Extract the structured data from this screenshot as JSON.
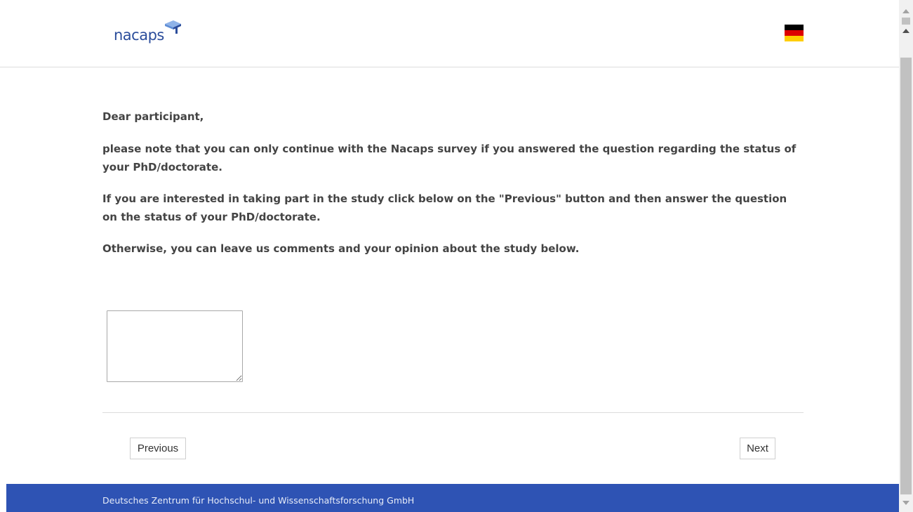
{
  "header": {
    "logo_text": "nacaps",
    "language_flag": "german-flag-icon"
  },
  "content": {
    "greeting": "Dear participant,",
    "paragraph1": "please note that you can only continue with the Nacaps survey if you answered the question regarding the status of your PhD/doctorate.",
    "paragraph2": "If you are interested in taking part in the study click below on the \"Previous\" button and then answer the question on the status of your PhD/doctorate.",
    "paragraph3": "Otherwise, you can leave us comments and your opinion about the study below.",
    "comment_value": ""
  },
  "navigation": {
    "previous_label": "Previous",
    "next_label": "Next"
  },
  "footer": {
    "text": "Deutsches Zentrum für Hochschul- und Wissenschaftsforschung GmbH"
  },
  "colors": {
    "brand_blue": "#2b4d9b",
    "footer_blue": "#2e53b4",
    "body_text": "#444444"
  }
}
